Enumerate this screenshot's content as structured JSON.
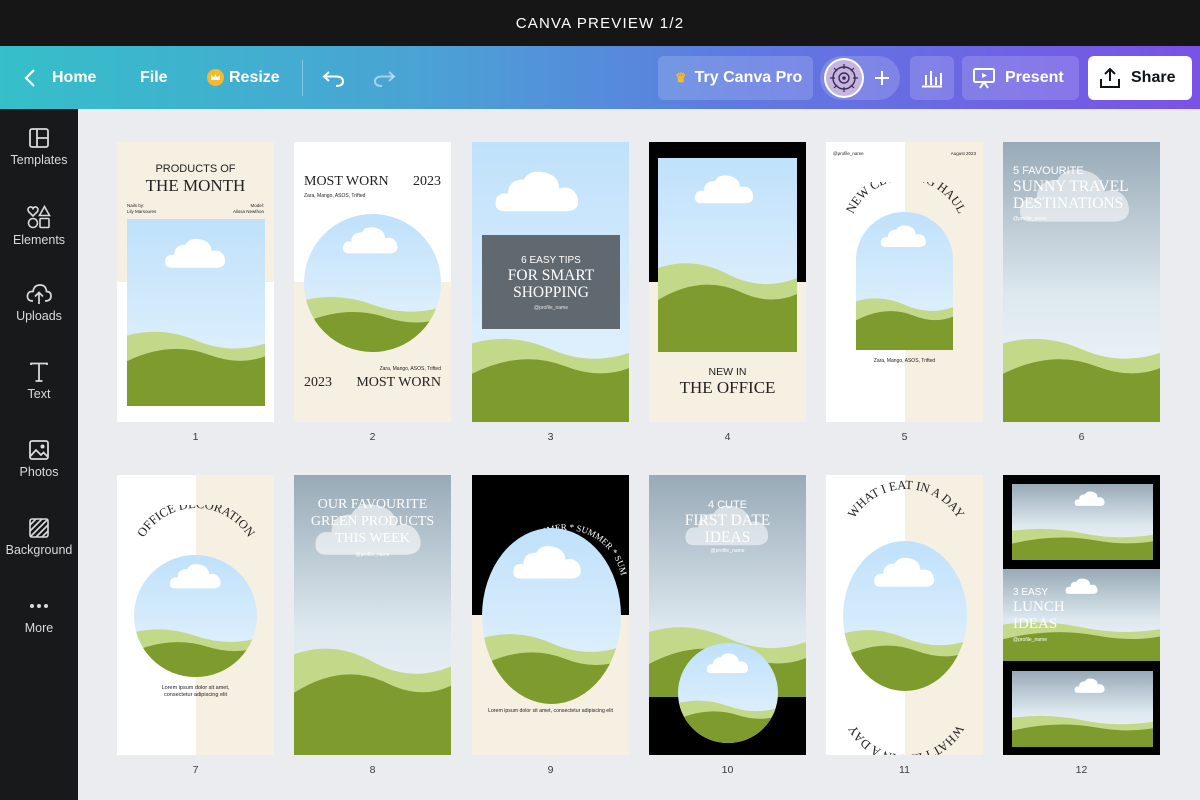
{
  "window": {
    "title": "CANVA PREVIEW 1/2"
  },
  "topbar": {
    "home": "Home",
    "file": "File",
    "resize": "Resize",
    "try_pro": "Try Canva Pro",
    "present": "Present",
    "share": "Share"
  },
  "sidebar": {
    "items": [
      {
        "label": "Templates",
        "icon": "templates-icon"
      },
      {
        "label": "Elements",
        "icon": "elements-icon"
      },
      {
        "label": "Uploads",
        "icon": "uploads-icon"
      },
      {
        "label": "Text",
        "icon": "text-icon"
      },
      {
        "label": "Photos",
        "icon": "photos-icon"
      },
      {
        "label": "Background",
        "icon": "background-icon"
      },
      {
        "label": "More",
        "icon": "more-icon"
      }
    ]
  },
  "colors": {
    "accent_teal": "#35bfc9",
    "accent_purple": "#7a52e6",
    "grass": "#7e9b2d",
    "light_grass": "#c3d98a",
    "cream": "#f6f0e2"
  },
  "pages": [
    {
      "num": "1",
      "title_small": "PRODUCTS OF",
      "title": "THE MONTH",
      "left_label": "Nails by:",
      "left_value": "Lily Marsoures",
      "right_label": "Model:",
      "right_value": "Alissa Newthon"
    },
    {
      "num": "2",
      "title_left": "MOST WORN",
      "year_top": "2023",
      "brands_top": "Zara, Mango, ASOS, Trifted",
      "brands_bottom": "Zara, Mango, ASOS, Trifted",
      "year_bottom": "2023",
      "title_bottom": "MOST WORN"
    },
    {
      "num": "3",
      "line1": "6 EASY TIPS",
      "line2": "FOR SMART",
      "line3": "SHOPPING",
      "handle": "@profile_name"
    },
    {
      "num": "4",
      "line1": "NEW IN",
      "line2": "THE OFFICE"
    },
    {
      "num": "5",
      "handle": "@profile_name",
      "date": "August 2023",
      "arc": "NEW CLOTHING HAUL",
      "brands": "Zara, Mango, ASOS, Trifted"
    },
    {
      "num": "6",
      "line1": "5 FAVOURITE",
      "line2": "SUNNY TRAVEL",
      "line3": "DESTINATIONS",
      "handle": "@profile_name"
    },
    {
      "num": "7",
      "arc": "OFFICE DECORATION",
      "body1": "Lorem ipsum dolor sit amet,",
      "body2": "consectetur adipiscing elit"
    },
    {
      "num": "8",
      "line1": "OUR FAVOURITE",
      "line2": "GREEN PRODUCTS",
      "line3": "THIS WEEK",
      "handle": "@profile_name"
    },
    {
      "num": "9",
      "arc": "SUMMER * SUMMER * SUM",
      "body": "Lorem ipsum dolor sit amet, consectetur adipiscing elit"
    },
    {
      "num": "10",
      "line1": "4 CUTE",
      "line2": "FIRST DATE",
      "line3": "IDEAS",
      "handle": "@profile_name"
    },
    {
      "num": "11",
      "arc_top": "WHAT I EAT IN A DAY",
      "arc_bottom": "WHAT I EAT IN A DAY"
    },
    {
      "num": "12",
      "line1": "3 EASY",
      "line2": "LUNCH",
      "line3": "IDEAS",
      "handle": "@profile_name"
    }
  ]
}
